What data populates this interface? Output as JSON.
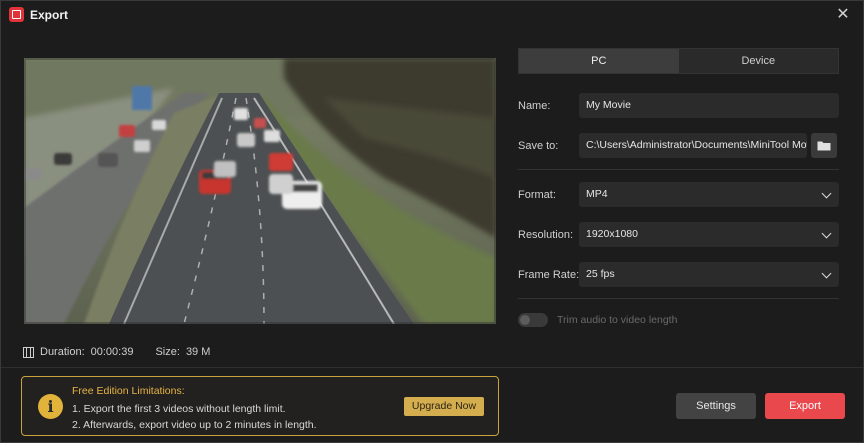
{
  "window": {
    "title": "Export",
    "close_glyph": "✕",
    "app_icon": "app-logo-icon"
  },
  "preview": {
    "description_icon": "film-icon",
    "duration_label": "Duration:",
    "duration_value": "00:00:39",
    "size_label": "Size:",
    "size_value": "39 M"
  },
  "tabs": [
    {
      "label": "PC",
      "active": true
    },
    {
      "label": "Device",
      "active": false
    }
  ],
  "form": {
    "name_label": "Name:",
    "name_value": "My Movie",
    "save_to_label": "Save to:",
    "save_to_value": "C:\\Users\\Administrator\\Documents\\MiniTool MovieMaker\\output",
    "format_label": "Format:",
    "format_value": "MP4",
    "resolution_label": "Resolution:",
    "resolution_value": "1920x1080",
    "frame_rate_label": "Frame Rate:",
    "frame_rate_value": "25 fps",
    "trim_label": "Trim audio to video length",
    "trim_enabled": false
  },
  "limitations": {
    "title": "Free Edition Limitations:",
    "line1": "1. Export the first 3 videos without length limit.",
    "line2": "2. Afterwards, export video up to 2 minutes in length.",
    "upgrade_label": "Upgrade Now"
  },
  "actions": {
    "settings_label": "Settings",
    "export_label": "Export"
  },
  "colors": {
    "accent_export": "#e9484d",
    "warning": "#e2b33b",
    "upgrade": "#d4ae4e"
  }
}
